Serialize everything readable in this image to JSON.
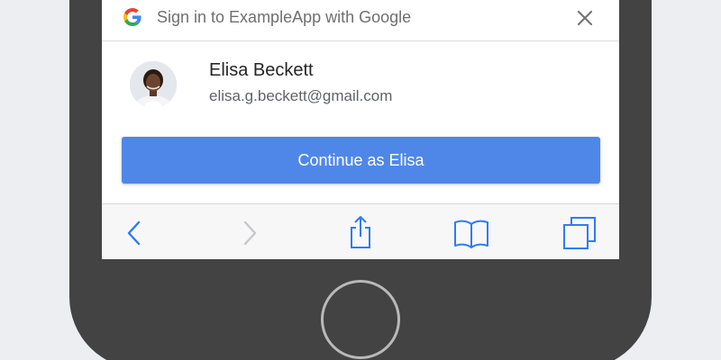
{
  "sheet": {
    "title": "Sign in to ExampleApp with Google",
    "logo_icon": "google-g-icon",
    "close_icon": "close-icon"
  },
  "account": {
    "name": "Elisa Beckett",
    "email": "elisa.g.beckett@gmail.com",
    "avatar_icon": "avatar"
  },
  "primary_button": {
    "label": "Continue as Elisa",
    "color": "#4f87e9"
  },
  "browser_toolbar": {
    "icons": [
      "back-icon",
      "forward-icon",
      "share-icon",
      "bookmarks-icon",
      "tabs-icon"
    ],
    "accent_color": "#2f7bf5"
  },
  "device": {
    "body_color": "#434343",
    "home_button_icon": "home-button"
  }
}
